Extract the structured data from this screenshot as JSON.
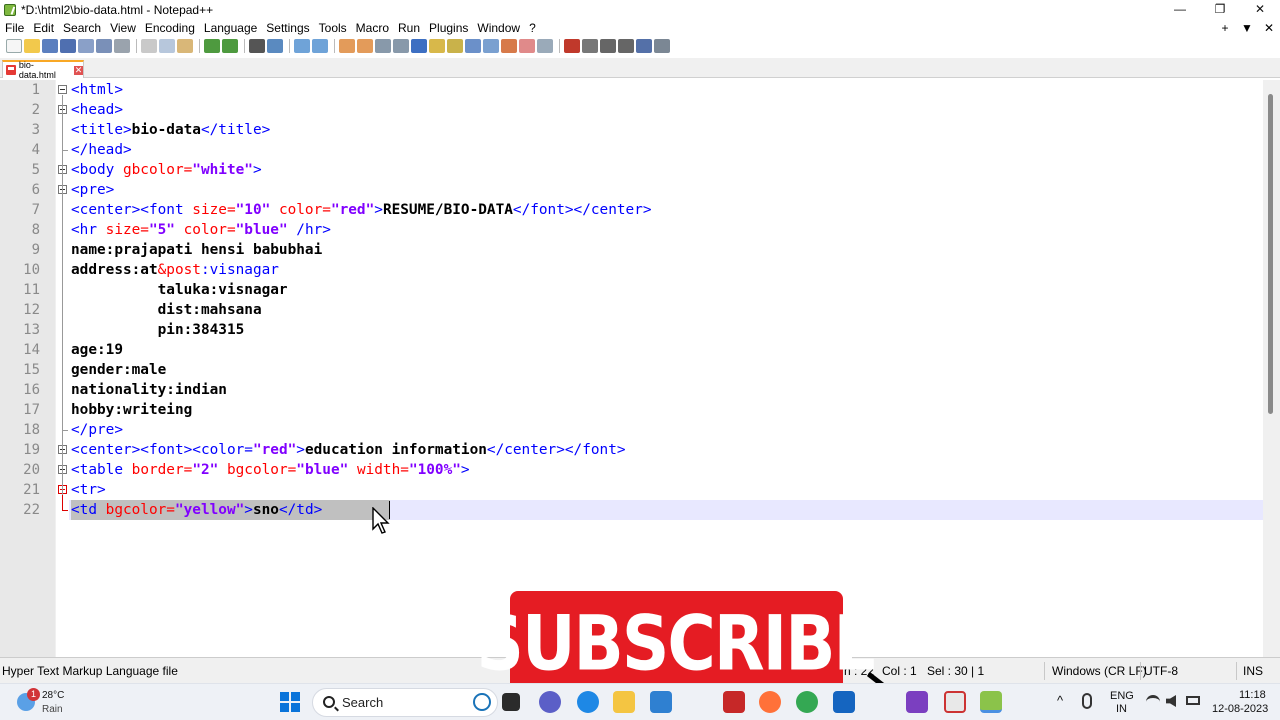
{
  "window": {
    "title": "*D:\\html2\\bio-data.html - Notepad++",
    "controls": [
      "—",
      "❐",
      "✕"
    ]
  },
  "menu": {
    "items": [
      "File",
      "Edit",
      "Search",
      "View",
      "Encoding",
      "Language",
      "Settings",
      "Tools",
      "Macro",
      "Run",
      "Plugins",
      "Window",
      "?"
    ],
    "right": [
      "+",
      "▼",
      "✕"
    ]
  },
  "tab": {
    "label": "bio-data.html",
    "close": "✕"
  },
  "editor": {
    "line_numbers": [
      "1",
      "2",
      "3",
      "4",
      "5",
      "6",
      "7",
      "8",
      "9",
      "10",
      "11",
      "12",
      "13",
      "14",
      "15",
      "16",
      "17",
      "18",
      "19",
      "20",
      "21",
      "22"
    ],
    "lines": [
      [
        [
          "t",
          "<html>"
        ]
      ],
      [
        [
          "t",
          "<head>"
        ]
      ],
      [
        [
          "t",
          "<title>"
        ],
        [
          "b",
          "bio-data"
        ],
        [
          "t",
          "</title>"
        ]
      ],
      [
        [
          "t",
          "</head>"
        ]
      ],
      [
        [
          "t",
          "<body "
        ],
        [
          "a",
          "gbcolor="
        ],
        [
          "v",
          "\"white\""
        ],
        [
          "t",
          ">"
        ]
      ],
      [
        [
          "t",
          "<pre>"
        ]
      ],
      [
        [
          "t",
          "<center><font "
        ],
        [
          "a",
          "size="
        ],
        [
          "v",
          "\"10\""
        ],
        [
          "a",
          " color="
        ],
        [
          "v",
          "\"red\""
        ],
        [
          "t",
          ">"
        ],
        [
          "b",
          "RESUME/BIO-DATA"
        ],
        [
          "t",
          "</font></center>"
        ]
      ],
      [
        [
          "t",
          "<hr "
        ],
        [
          "a",
          "size="
        ],
        [
          "v",
          "\"5\""
        ],
        [
          "a",
          " color="
        ],
        [
          "v",
          "\"blue\""
        ],
        [
          "t",
          " /hr>"
        ]
      ],
      [
        [
          "b",
          "name:prajapati hensi babubhai"
        ]
      ],
      [
        [
          "b",
          "address:at"
        ],
        [
          "a",
          "&post"
        ],
        [
          "t",
          ":visnagar"
        ]
      ],
      [
        [
          "b",
          "          taluka:visnagar"
        ]
      ],
      [
        [
          "b",
          "          dist:mahsana"
        ]
      ],
      [
        [
          "b",
          "          pin:384315"
        ]
      ],
      [
        [
          "b",
          "age:19"
        ]
      ],
      [
        [
          "b",
          "gender:male"
        ]
      ],
      [
        [
          "b",
          "nationality:indian"
        ]
      ],
      [
        [
          "b",
          "hobby:writeing"
        ]
      ],
      [
        [
          "t",
          "</pre>"
        ]
      ],
      [
        [
          "t",
          "<center><font><color="
        ],
        [
          "v",
          "\"red\""
        ],
        [
          "t",
          ">"
        ],
        [
          "b",
          "education information"
        ],
        [
          "t",
          "</center></font>"
        ]
      ],
      [
        [
          "t",
          "<table "
        ],
        [
          "a",
          "border="
        ],
        [
          "v",
          "\"2\""
        ],
        [
          "a",
          " bgcolor="
        ],
        [
          "v",
          "\"blue\""
        ],
        [
          "a",
          " width="
        ],
        [
          "v",
          "\"100%\""
        ],
        [
          "t",
          ">"
        ]
      ],
      [
        [
          "t",
          "<tr>"
        ]
      ],
      [
        [
          "t",
          "<td "
        ],
        [
          "a",
          "bgcolor="
        ],
        [
          "v",
          "\"yellow\""
        ],
        [
          "t",
          ">"
        ],
        [
          "b",
          "sno"
        ],
        [
          "t",
          "</td>"
        ]
      ]
    ]
  },
  "status": {
    "filetype": "Hyper Text Markup Language file",
    "position": "n : 22",
    "col": "Col : 1",
    "sel": "Sel : 30 | 1",
    "eol": "Windows (CR LF)",
    "encoding": "UTF-8",
    "mode": "INS"
  },
  "overlay": {
    "subscribe": "SUBSCRIBE"
  },
  "taskbar": {
    "weather_badge": "1",
    "temperature": "28°C",
    "condition": "Rain",
    "search_placeholder": "Search",
    "lang_top": "ENG",
    "lang_bottom": "IN",
    "time": "11:18",
    "date": "12-08-2023",
    "tray_chevron": "^"
  },
  "colors": {
    "tag": "#0000ff",
    "attribute": "#ff0000",
    "value": "#8000ff",
    "subscribe": "#e51c23"
  }
}
